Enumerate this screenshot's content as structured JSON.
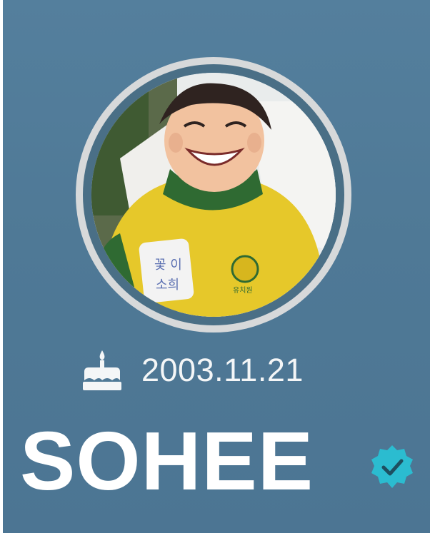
{
  "profile": {
    "birthday": "2003.11.21",
    "name": "SOHEE",
    "avatar": "child-photo",
    "icons": {
      "birthday": "cake-icon",
      "verified": "verified-badge-icon"
    },
    "colors": {
      "background": "#4f7996",
      "ring": "#d7d9da",
      "verified": "#2bbcd0",
      "text": "#ffffff"
    }
  }
}
